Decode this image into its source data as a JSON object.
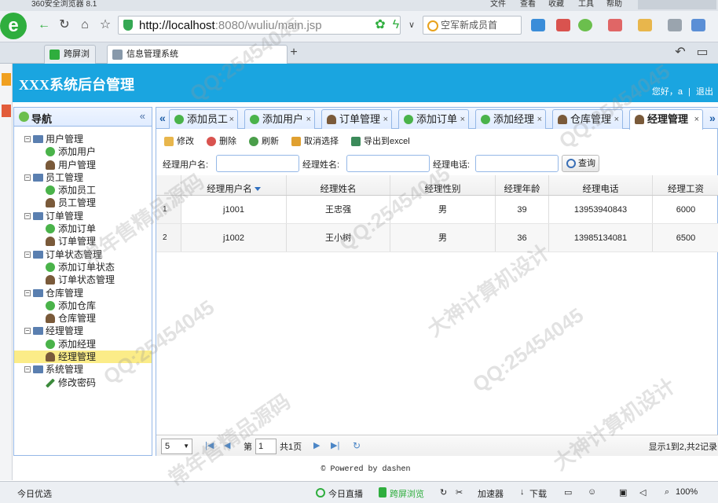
{
  "browser": {
    "app_title": "360安全浏览器 8.1",
    "menu": [
      "文件",
      "查看",
      "收藏",
      "工具",
      "帮助"
    ],
    "url_host": "http://localhost",
    "url_path": ":8080/wuliu/main.jsp",
    "search_placeholder": "空军新成员首",
    "tabs": [
      {
        "label": "跨屏浏览"
      },
      {
        "label": "信息管理系统"
      }
    ]
  },
  "header": {
    "title": "XXX系统后台管理",
    "greeting": "您好，a",
    "separator": "|",
    "logout": "退出"
  },
  "nav": {
    "title": "导航",
    "collapse": "«",
    "groups": [
      {
        "label": "用户管理",
        "items": [
          "添加用户",
          "用户管理"
        ]
      },
      {
        "label": "员工管理",
        "items": [
          "添加员工",
          "员工管理"
        ]
      },
      {
        "label": "订单管理",
        "items": [
          "添加订单",
          "订单管理"
        ]
      },
      {
        "label": "订单状态管理",
        "items": [
          "添加订单状态",
          "订单状态管理"
        ]
      },
      {
        "label": "仓库管理",
        "items": [
          "添加仓库",
          "仓库管理"
        ]
      },
      {
        "label": "经理管理",
        "items": [
          "添加经理",
          "经理管理"
        ]
      },
      {
        "label": "系统管理",
        "items": [
          "修改密码"
        ]
      }
    ],
    "selected": "经理管理"
  },
  "tabs": [
    {
      "label": "添加员工",
      "close": "×"
    },
    {
      "label": "添加用户",
      "close": "×"
    },
    {
      "label": "订单管理",
      "close": "×"
    },
    {
      "label": "添加订单",
      "close": "×"
    },
    {
      "label": "添加经理",
      "close": "×"
    },
    {
      "label": "仓库管理",
      "close": "×"
    },
    {
      "label": "经理管理",
      "close": "×"
    }
  ],
  "toolbar": {
    "edit": "修改",
    "delete": "删除",
    "refresh": "刷新",
    "cancel_select": "取消选择",
    "export": "导出到excel"
  },
  "filters": {
    "username_label": "经理用户名:",
    "name_label": "经理姓名:",
    "phone_label": "经理电话:",
    "query": "查询"
  },
  "grid": {
    "columns": [
      "经理用户名",
      "经理姓名",
      "经理性别",
      "经理年龄",
      "经理电话",
      "经理工资"
    ],
    "rows": [
      {
        "num": "1",
        "cells": [
          "j1001",
          "王忠强",
          "男",
          "39",
          "13953940843",
          "6000"
        ]
      },
      {
        "num": "2",
        "cells": [
          "j1002",
          "王小树",
          "男",
          "36",
          "13985134081",
          "6500"
        ]
      }
    ]
  },
  "pager": {
    "page_size": "5",
    "page_prefix": "第",
    "page_value": "1",
    "page_suffix": "共1页",
    "summary": "显示1到2,共2记录"
  },
  "footer": "© Powered by dashen",
  "status": {
    "left": "今日优选",
    "live": "今日直播",
    "cross": "跨屏浏览",
    "accel": "加速器",
    "download": "下载",
    "zoom": "100%"
  },
  "watermarks": [
    "QQ:25454045",
    "大神计算机设计",
    "常年售精品源码"
  ]
}
